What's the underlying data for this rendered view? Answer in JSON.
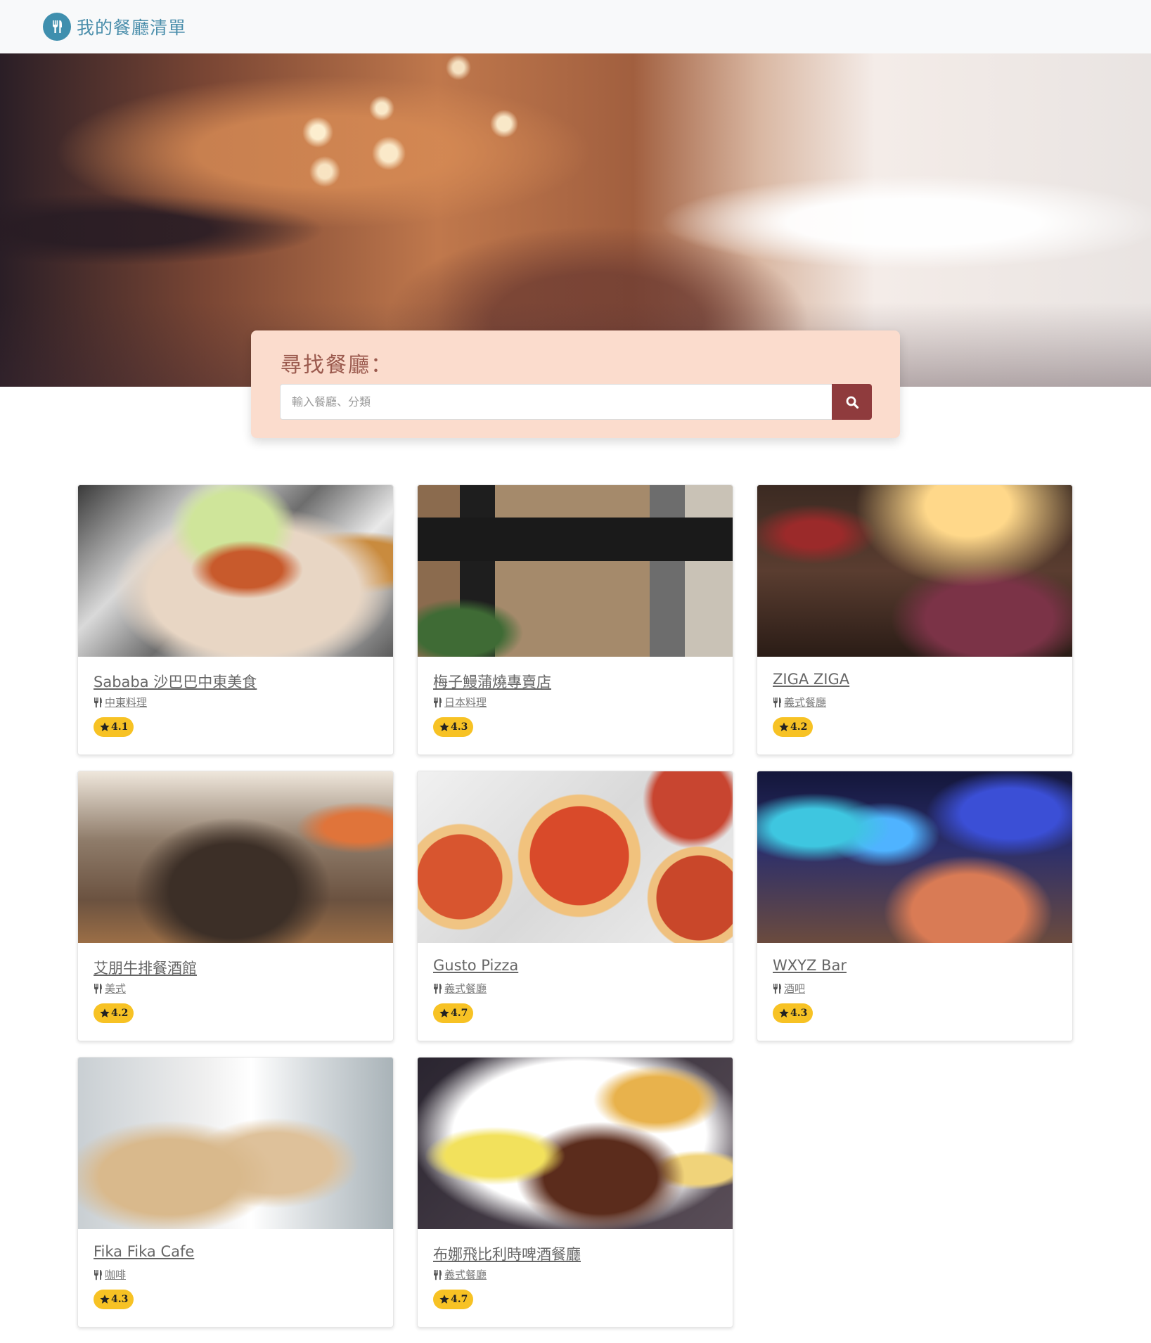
{
  "brand": {
    "title": "我的餐廳清單",
    "icon": "utensils-icon",
    "color": "#4a8eab"
  },
  "search": {
    "title": "尋找餐廳：",
    "placeholder": "輸入餐廳、分類",
    "button_icon": "search-icon",
    "button_color": "#8f3b3d"
  },
  "restaurants": [
    {
      "name": "Sababa 沙巴巴中東美食",
      "category": "中東料理",
      "rating": "4.1"
    },
    {
      "name": "梅子鰻蒲燒專賣店",
      "category": "日本料理",
      "rating": "4.3"
    },
    {
      "name": "ZIGA ZIGA",
      "category": "義式餐廳",
      "rating": "4.2"
    },
    {
      "name": "艾朋牛排餐酒館",
      "category": "美式",
      "rating": "4.2"
    },
    {
      "name": "Gusto Pizza",
      "category": "義式餐廳",
      "rating": "4.7"
    },
    {
      "name": "WXYZ Bar",
      "category": "酒吧",
      "rating": "4.3"
    },
    {
      "name": "Fika Fika Cafe",
      "category": "咖啡",
      "rating": "4.3"
    },
    {
      "name": "布娜飛比利時啤酒餐廳",
      "category": "義式餐廳",
      "rating": "4.7"
    }
  ],
  "colors": {
    "rating_badge": "#f7c224",
    "search_panel": "#fbdccd"
  }
}
